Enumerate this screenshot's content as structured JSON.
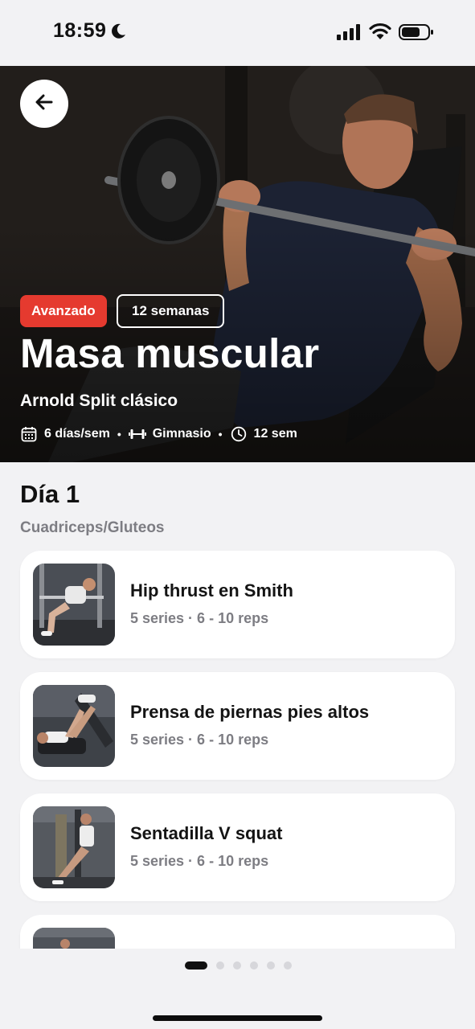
{
  "status_bar": {
    "time": "18:59",
    "icons": [
      "moon-icon",
      "cellular-signal-icon",
      "wifi-icon",
      "battery-icon"
    ]
  },
  "hero": {
    "level_badge": "Avanzado",
    "weeks_badge": "12 semanas",
    "title": "Masa muscular",
    "subtitle": "Arnold Split clásico",
    "meta": {
      "days": "6 días/sem",
      "place": "Gimnasio",
      "duration": "12 sem"
    },
    "accent_color": "#e53a2f"
  },
  "day": {
    "title": "Día 1",
    "subtitle": "Cuadriceps/Gluteos"
  },
  "exercises": [
    {
      "name": "Hip thrust en Smith",
      "detail": "5 series · 6 - 10 reps"
    },
    {
      "name": "Prensa de piernas pies altos",
      "detail": "5 series · 6 - 10 reps"
    },
    {
      "name": "Sentadilla V squat",
      "detail": "5 series · 6 - 10 reps"
    }
  ],
  "pager": {
    "pages": 6,
    "active_index": 0
  }
}
